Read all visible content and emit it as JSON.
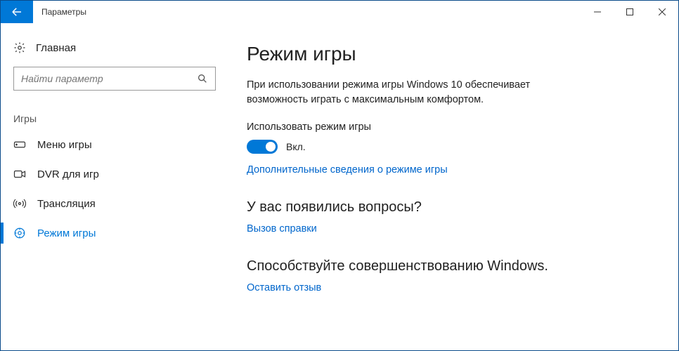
{
  "window": {
    "title": "Параметры"
  },
  "sidebar": {
    "home": "Главная",
    "search_placeholder": "Найти параметр",
    "group": "Игры",
    "items": [
      {
        "label": "Меню игры"
      },
      {
        "label": "DVR для игр"
      },
      {
        "label": "Трансляция"
      },
      {
        "label": "Режим игры"
      }
    ]
  },
  "main": {
    "title": "Режим игры",
    "description": "При использовании режима игры Windows 10 обеспечивает возможность играть с максимальным комфортом.",
    "toggle_label": "Использовать режим игры",
    "toggle_state": "Вкл.",
    "learn_more": "Дополнительные сведения о режиме игры",
    "questions_heading": "У вас появились вопросы?",
    "help_link": "Вызов справки",
    "feedback_heading": "Способствуйте совершенствованию Windows.",
    "feedback_link": "Оставить отзыв"
  }
}
